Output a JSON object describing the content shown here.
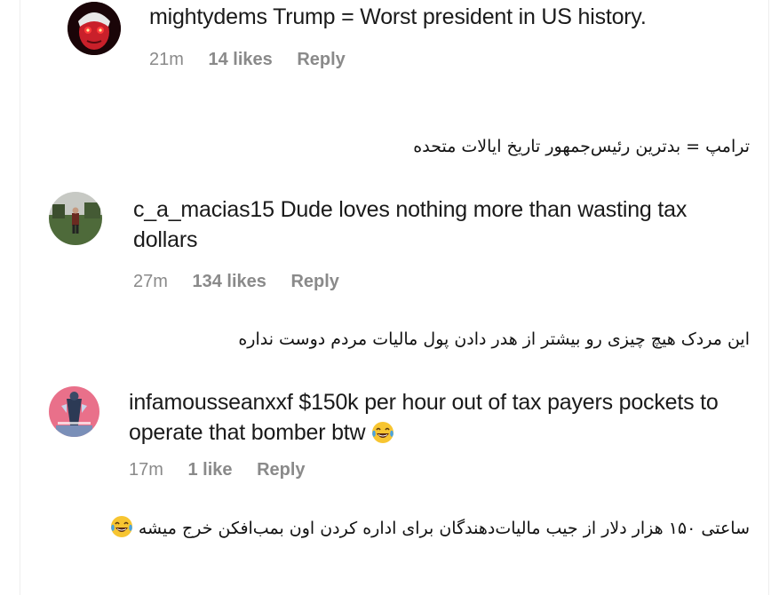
{
  "comments": [
    {
      "username": "mightydems",
      "text": "Trump = Worst president in US history.",
      "time": "21m",
      "likes": "14 likes",
      "reply": "Reply",
      "translation": "ترامپ = بدترین رئیس‌جمهور تاریخ ایالات متحده"
    },
    {
      "username": "c_a_macias15",
      "text": "Dude loves nothing more than wasting tax dollars",
      "time": "27m",
      "likes": "134 likes",
      "reply": "Reply",
      "translation": "این مردک هیچ چیزی رو بیشتر از هدر دادن پول مالیات مردم دوست نداره"
    },
    {
      "username": "infamousseanxxf",
      "text": "$150k per hour out of tax payers pockets to operate that bomber btw",
      "emoji": "laughing-tears-emoji",
      "time": "17m",
      "likes": "1 like",
      "reply": "Reply",
      "translation": "ساعتی ۱۵۰ هزار دلار از جیب مالیات‌دهندگان برای اداره کردن اون بمب‌افکن خرج میشه"
    }
  ],
  "colors": {
    "text": "#1a1a1a",
    "meta": "#8a8a8a",
    "emoji_face": "#f7c531",
    "emoji_tears": "#4aa3e0"
  }
}
